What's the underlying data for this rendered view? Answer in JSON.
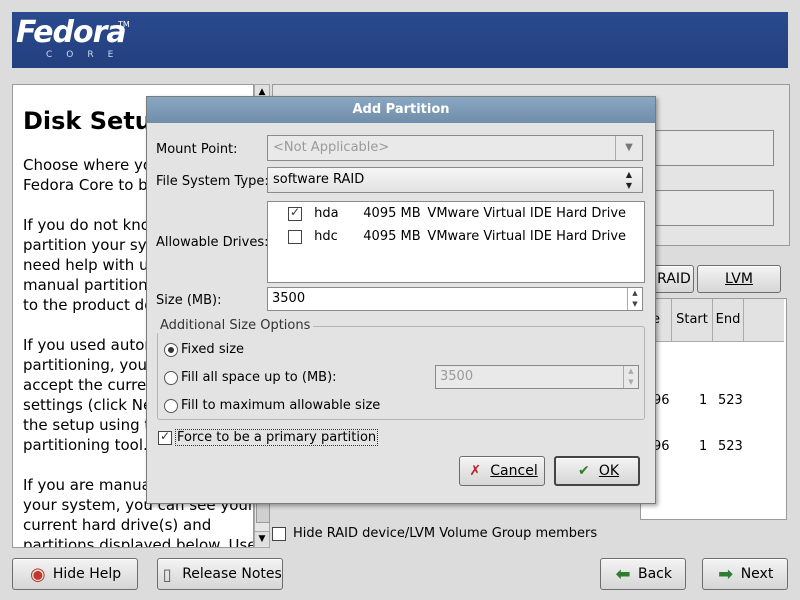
{
  "banner": {
    "brand": "Fedora",
    "sub": "CORE",
    "tm": "TM"
  },
  "help": {
    "title": "Disk Setup",
    "para1": "Choose where you would like\nFedora Core to be installed.",
    "para2": "If you do not know how to\npartition your system or if you\nneed help with using the\nmanual partitioning tools, refer\nto the product documentation.",
    "para3": "If you used automatic\npartitioning, you can either\naccept the current partition\nsettings (click Next), or modify\nthe setup using the manual\npartitioning tool.",
    "para4": "If you are manually partitioning\nyour system, you can see your\ncurrent hard drive(s) and\npartitions displayed below. Use"
  },
  "right": {
    "raid_btn": "RAID",
    "lvm_btn": "LVM",
    "headers": [
      "e",
      "Start",
      "End"
    ],
    "rows": [
      {
        "size": "96",
        "start": "1",
        "end": "523"
      },
      {
        "size": "96",
        "start": "1",
        "end": "523"
      }
    ],
    "hide_raid_label": "Hide RAID device/LVM Volume Group members"
  },
  "dialog": {
    "title": "Add Partition",
    "mount_label": "Mount Point:",
    "mount_placeholder": "<Not Applicable>",
    "fstype_label": "File System Type:",
    "fstype_value": "software RAID",
    "drives_label": "Allowable Drives:",
    "drives": [
      {
        "name": "hda",
        "size": "4095 MB",
        "model": "VMware Virtual IDE Hard Drive",
        "checked": true
      },
      {
        "name": "hdc",
        "size": "4095 MB",
        "model": "VMware Virtual IDE Hard Drive",
        "checked": false
      }
    ],
    "size_label": "Size (MB):",
    "size_value": "3500",
    "additional_legend": "Additional Size Options",
    "opt_fixed": "Fixed size",
    "opt_fill_upto": "Fill all space up to (MB):",
    "fill_upto_value": "3500",
    "opt_fill_max": "Fill to maximum allowable size",
    "force_primary": "Force to be a primary partition",
    "cancel": "Cancel",
    "ok": "OK"
  },
  "bottom": {
    "hide_help": "Hide Help",
    "release_notes": "Release Notes",
    "back": "Back",
    "next": "Next"
  },
  "colors": {
    "banner": "#23407e",
    "dialog_title": "#7b99b5"
  }
}
